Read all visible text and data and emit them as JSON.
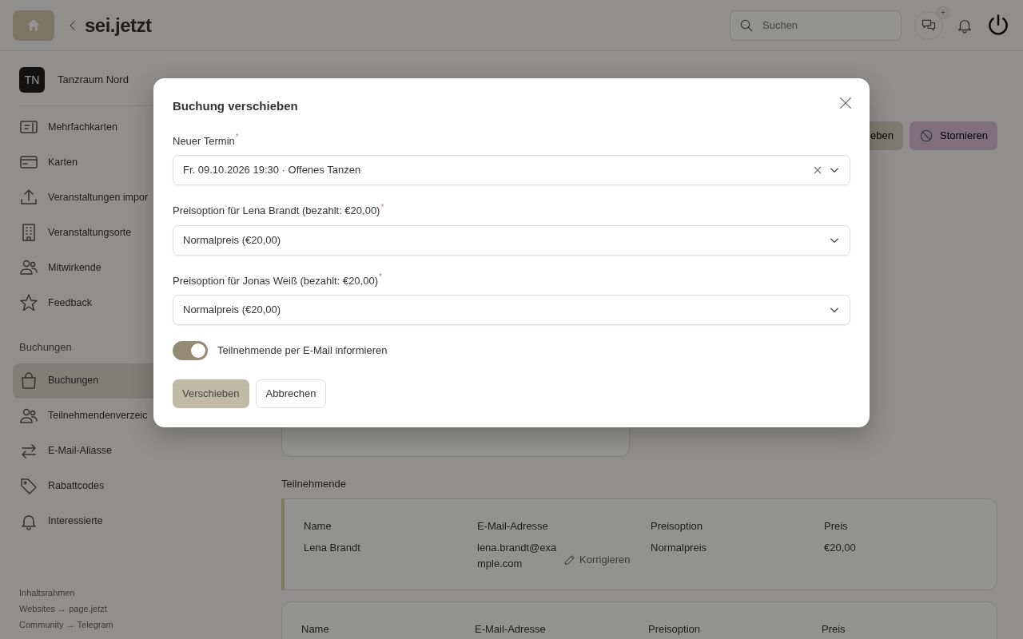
{
  "header": {
    "logo": "sei.jetzt",
    "search": {
      "placeholder": "Suchen"
    },
    "chat_badge": "+"
  },
  "sidebar": {
    "org": {
      "initials": "TN",
      "name": "Tanzraum Nord"
    },
    "groups": [
      {
        "items": [
          {
            "label": "Mehrfachkarten",
            "selected": false
          },
          {
            "label": "Karten",
            "selected": false
          },
          {
            "label": "Veranstaltungen impor",
            "selected": false
          },
          {
            "label": "Veranstaltungsorte",
            "selected": false
          },
          {
            "label": "Mitwirkende",
            "selected": false
          },
          {
            "label": "Feedback",
            "selected": false
          }
        ]
      },
      {
        "label": "Buchungen",
        "items": [
          {
            "label": "Buchungen",
            "selected": true
          },
          {
            "label": "Teilnehmendenverzeic",
            "selected": false
          },
          {
            "label": "E-Mail-Aliasse",
            "selected": false
          },
          {
            "label": "Rabattcodes",
            "selected": false
          },
          {
            "label": "Interessierte",
            "selected": false
          }
        ]
      }
    ],
    "footer": [
      "Inhaltsrahmen",
      "Websites → page.jetzt",
      "Community → Telegram"
    ]
  },
  "actions": [
    {
      "kind": "move",
      "label": "eben"
    },
    {
      "kind": "cancel",
      "label": "Stornieren"
    }
  ],
  "participants": {
    "title": "Teilnehmende",
    "cards": [
      {
        "highlighted": true,
        "columns": [
          "Name",
          "E-Mail-Adresse",
          "Preisoption",
          "Preis"
        ],
        "name": "Lena Brandt",
        "email": "lena.brandt@example.com",
        "edit": "Korrigieren",
        "option": "Normalpreis",
        "price": "€20,00"
      },
      {
        "highlighted": false,
        "columns": [
          "Name",
          "E-Mail-Adresse",
          "Preisoption",
          "Preis"
        ]
      }
    ]
  },
  "modal": {
    "title": "Buchung verschieben",
    "fields": [
      {
        "label": "Neuer Termin",
        "required_mark": "*",
        "value": "Fr. 09.10.2026 19:30 · Offenes Tanzen",
        "clearable": true
      },
      {
        "label": "Preisoption für Lena Brandt (bezahlt: €20,00)",
        "required_mark": "*",
        "value": "Normalpreis (€20,00)",
        "clearable": false
      },
      {
        "label": "Preisoption für Jonas Weiß (bezahlt: €20,00)",
        "required_mark": "*",
        "value": "Normalpreis (€20,00)",
        "clearable": false
      }
    ],
    "toggle": {
      "label": "Teilnehmende per E-Mail informieren",
      "on": true
    },
    "buttons": [
      {
        "kind": "primary",
        "label": "Verschieben"
      },
      {
        "kind": "secondary",
        "label": "Abbrechen"
      }
    ]
  }
}
